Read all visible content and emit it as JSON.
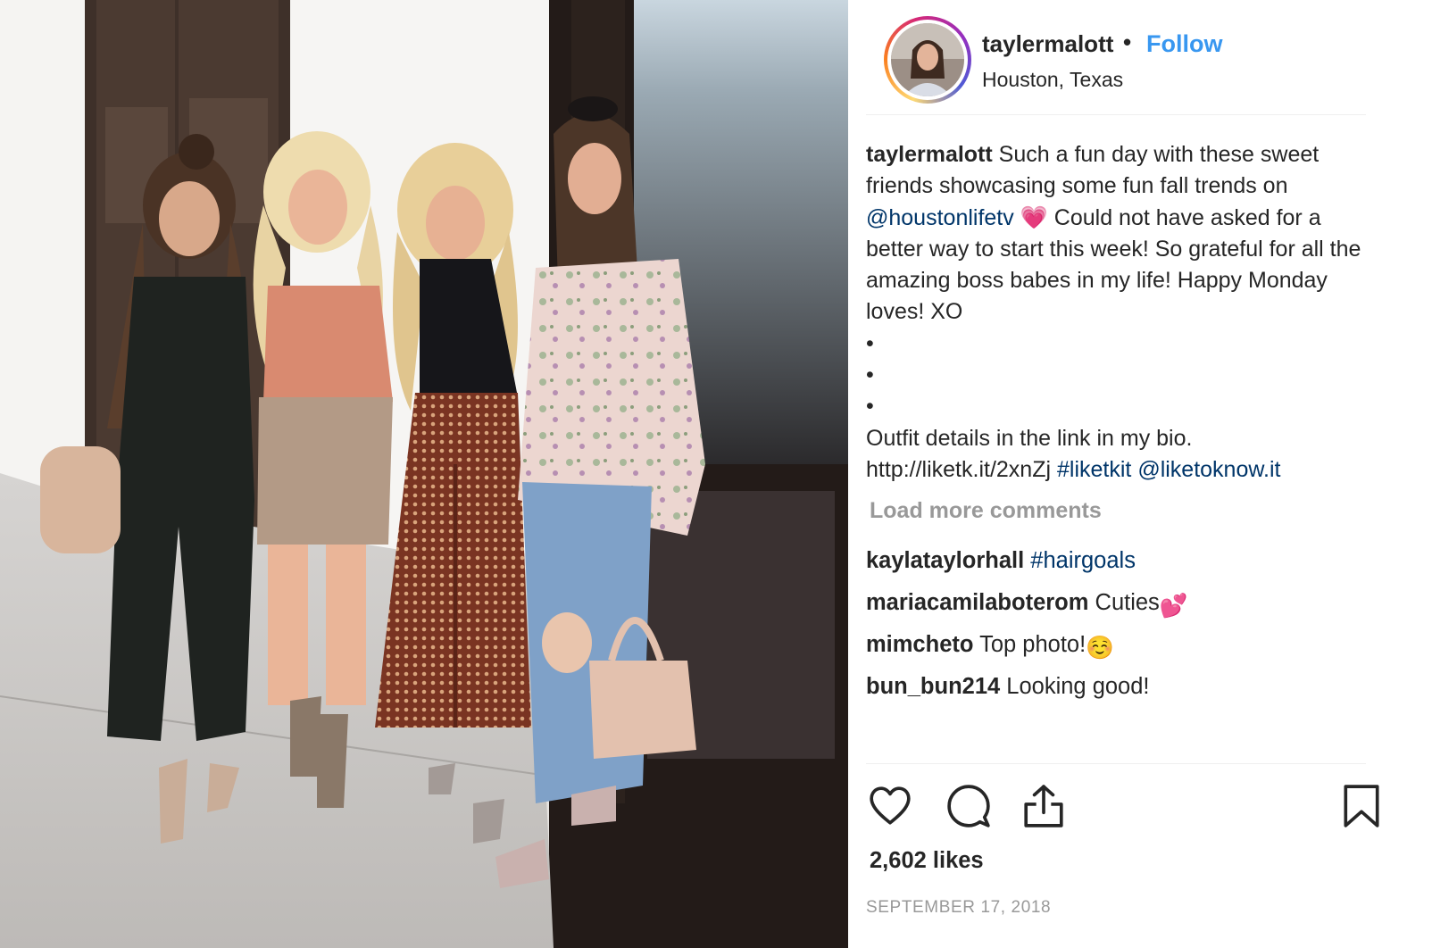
{
  "author": {
    "username": "taylermalott",
    "separator": "•",
    "follow_label": "Follow",
    "location": "Houston, Texas"
  },
  "photo": {
    "icon": "post-photo-four-women"
  },
  "caption": {
    "username": "taylermalott",
    "part1": "Such a fun day with these sweet friends showcasing some fun fall trends on ",
    "mention1": "@houstonlifetv",
    "heart_emoji": "💗",
    "part2": " Could not have asked for a better way to start this week! So grateful for all the amazing boss babes in my life! Happy Monday loves! XO",
    "bullets": [
      "•",
      "•",
      "•"
    ],
    "part3": "Outfit details in the link in my bio.",
    "url": "http://liketk.it/2xnZj",
    "hashtag": "#liketkit",
    "mention2": "@liketoknow.it"
  },
  "load_more_label": "Load more comments",
  "comments": [
    {
      "username": "kaylataylorhall",
      "text": "",
      "link": "#hairgoals",
      "emoji": ""
    },
    {
      "username": "mariacamilaboterom",
      "text": "Cuties",
      "link": "",
      "emoji": "💕"
    },
    {
      "username": "mimcheto",
      "text": "Top photo!",
      "link": "",
      "emoji": "☺️"
    },
    {
      "username": "bun_bun214",
      "text": "Looking good!",
      "link": "",
      "emoji": ""
    }
  ],
  "actions": {
    "like_icon": "heart-icon",
    "comment_icon": "comment-bubble-icon",
    "share_icon": "share-upload-icon",
    "save_icon": "bookmark-icon"
  },
  "likes": "2,602 likes",
  "date": "SEPTEMBER 17, 2018",
  "colors": {
    "link": "#003569",
    "follow": "#3897f0",
    "muted": "#999999",
    "text": "#262626"
  }
}
